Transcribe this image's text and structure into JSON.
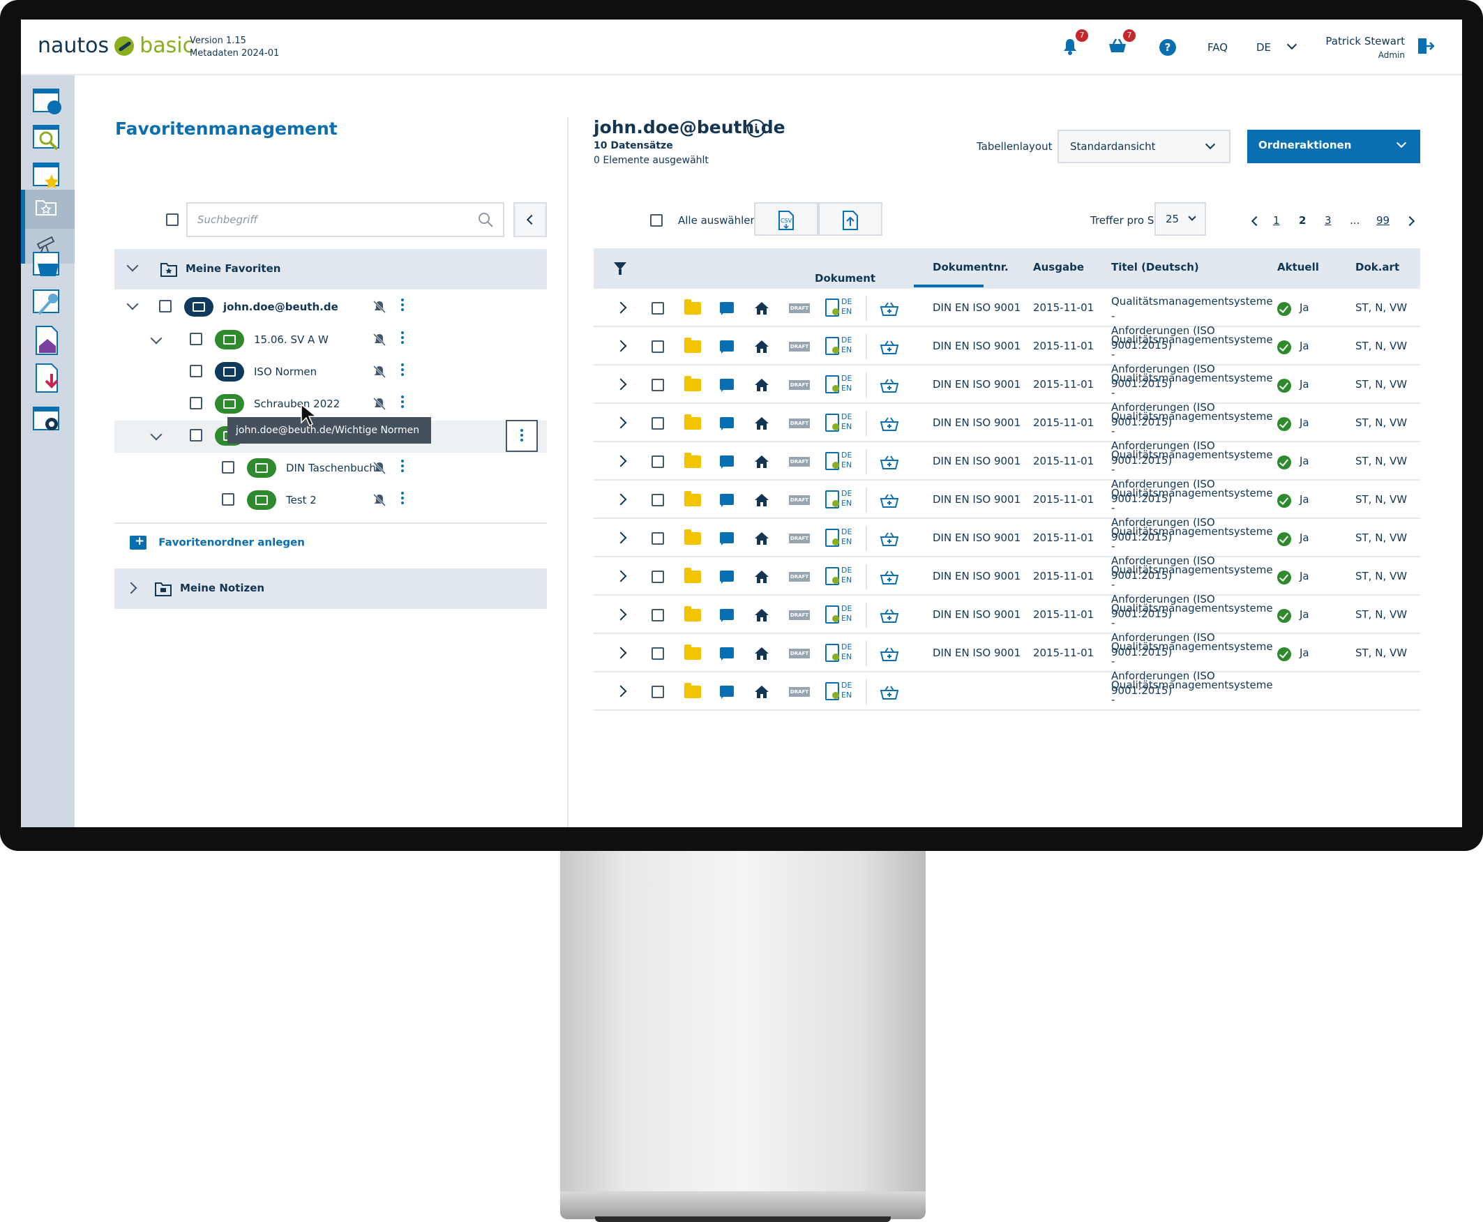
{
  "header": {
    "logo_primary": "nautos",
    "logo_secondary": "basic",
    "version": "Version 1.15",
    "metadata": "Metadaten 2024-01",
    "notifications_count": "7",
    "basket_count": "7",
    "help_label": "?",
    "faq_label": "FAQ",
    "language": "DE",
    "user_name": "Patrick Stewart",
    "user_role": "Admin"
  },
  "left_panel": {
    "title": "Favoritenmanagement",
    "search_placeholder": "Suchbegriff",
    "tree": {
      "root_label": "Meine Favoriten",
      "items": [
        {
          "label": "john.doe@beuth.de",
          "bold": true
        },
        {
          "label": "15.06. SV A W"
        },
        {
          "label": "ISO Normen"
        },
        {
          "label": "Schrauben 2022"
        },
        {
          "label": ""
        },
        {
          "label": "DIN Taschenbuch"
        },
        {
          "label": "Test 2"
        }
      ],
      "tooltip": "john.doe@beuth.de/Wichtige Normen"
    },
    "add_folder_label": "Favoritenordner anlegen",
    "notes_label": "Meine Notizen"
  },
  "right_panel": {
    "title": "john.doe@beuth.de",
    "info_label": "i",
    "records": "10 Datensätze",
    "selected": "0 Elemente ausgewählt",
    "table_layout_label": "Tabellenlayout",
    "table_layout_value": "Standardansicht",
    "folder_actions_label": "Ordneraktionen",
    "select_all_label": "Alle auswählen",
    "hits_per_page_label": "Treffer pro Seite",
    "hits_per_page_value": "25",
    "pagination": [
      "1",
      "2",
      "3",
      "...",
      "99"
    ],
    "current_page": "2",
    "columns": {
      "document": "Dokument",
      "doc_number": "Dokumentnr.",
      "edition": "Ausgabe",
      "title": "Titel (Deutsch)",
      "current": "Aktuell",
      "doc_type": "Dok.art"
    },
    "row_badges": {
      "draft": "DRAFT",
      "lang_de": "DE",
      "lang_en": "EN"
    },
    "rows": [
      {
        "doc_number": "DIN EN ISO 9001",
        "edition": "2015-11-01",
        "title_line1": "Qualitätsmanagementsysteme -",
        "title_line2": "Anforderungen (ISO 9001:2015)",
        "current": "Ja",
        "doc_type": "ST, N, VW"
      },
      {
        "doc_number": "DIN EN ISO 9001",
        "edition": "2015-11-01",
        "title_line1": "Qualitätsmanagementsysteme -",
        "title_line2": "Anforderungen (ISO 9001:2015)",
        "current": "Ja",
        "doc_type": "ST, N, VW"
      },
      {
        "doc_number": "DIN EN ISO 9001",
        "edition": "2015-11-01",
        "title_line1": "Qualitätsmanagementsysteme -",
        "title_line2": "Anforderungen (ISO 9001:2015)",
        "current": "Ja",
        "doc_type": "ST, N, VW"
      },
      {
        "doc_number": "DIN EN ISO 9001",
        "edition": "2015-11-01",
        "title_line1": "Qualitätsmanagementsysteme -",
        "title_line2": "Anforderungen (ISO 9001:2015)",
        "current": "Ja",
        "doc_type": "ST, N, VW"
      },
      {
        "doc_number": "DIN EN ISO 9001",
        "edition": "2015-11-01",
        "title_line1": "Qualitätsmanagementsysteme -",
        "title_line2": "Anforderungen (ISO 9001:2015)",
        "current": "Ja",
        "doc_type": "ST, N, VW"
      },
      {
        "doc_number": "DIN EN ISO 9001",
        "edition": "2015-11-01",
        "title_line1": "Qualitätsmanagementsysteme -",
        "title_line2": "Anforderungen (ISO 9001:2015)",
        "current": "Ja",
        "doc_type": "ST, N, VW"
      },
      {
        "doc_number": "DIN EN ISO 9001",
        "edition": "2015-11-01",
        "title_line1": "Qualitätsmanagementsysteme -",
        "title_line2": "Anforderungen (ISO 9001:2015)",
        "current": "Ja",
        "doc_type": "ST, N, VW"
      },
      {
        "doc_number": "DIN EN ISO 9001",
        "edition": "2015-11-01",
        "title_line1": "Qualitätsmanagementsysteme -",
        "title_line2": "Anforderungen (ISO 9001:2015)",
        "current": "Ja",
        "doc_type": "ST, N, VW"
      },
      {
        "doc_number": "DIN EN ISO 9001",
        "edition": "2015-11-01",
        "title_line1": "Qualitätsmanagementsysteme -",
        "title_line2": "Anforderungen (ISO 9001:2015)",
        "current": "Ja",
        "doc_type": "ST, N, VW"
      },
      {
        "doc_number": "DIN EN ISO 9001",
        "edition": "2015-11-01",
        "title_line1": "Qualitätsmanagementsysteme -",
        "title_line2": "Anforderungen (ISO 9001:2015)",
        "current": "Ja",
        "doc_type": "ST, N, VW"
      },
      {
        "doc_number": "",
        "edition": "",
        "title_line1": "Qualitätsmanagementsysteme -",
        "title_line2": "",
        "current": "",
        "doc_type": ""
      }
    ]
  },
  "colors": {
    "primary": "#0a6fb0",
    "navy": "#123553",
    "green": "#2f8a2d",
    "folder_yellow": "#f2c400",
    "sidebar": "#d0d9e2",
    "badge_red": "#c7272a"
  },
  "icons": [
    "bell-icon",
    "basket-icon",
    "help-icon",
    "logout-icon",
    "search-icon",
    "folder-icon",
    "note-icon",
    "home-icon",
    "document-icon",
    "filter-icon",
    "csv-export-icon",
    "upload-icon",
    "bell-off-icon",
    "more-vertical-icon"
  ]
}
